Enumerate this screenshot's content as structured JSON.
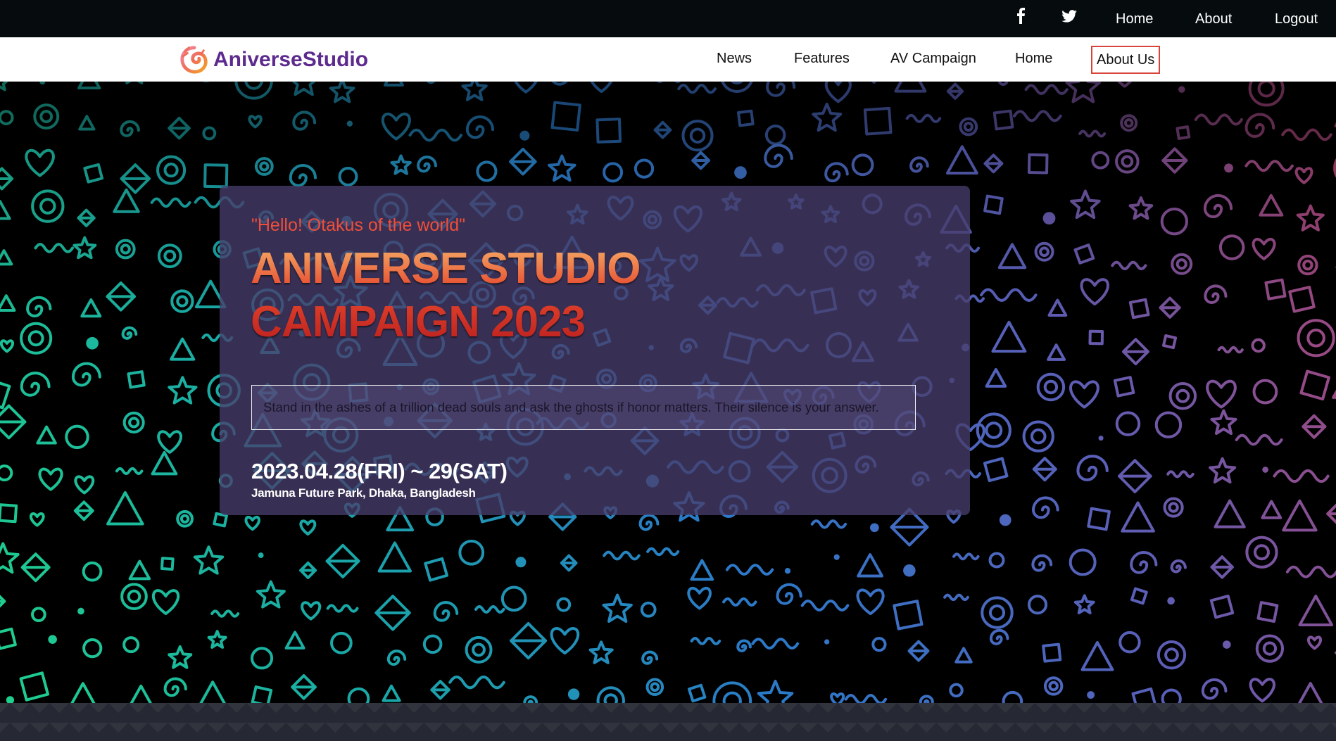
{
  "topbar": {
    "social": [
      {
        "name": "facebook-icon",
        "glyph": "f"
      },
      {
        "name": "twitter-icon",
        "glyph": "🐦"
      }
    ],
    "links": [
      "Home",
      "About",
      "Logout"
    ]
  },
  "navbar": {
    "brand": "AniverseStudio",
    "links": [
      "News",
      "Features",
      "AV Campaign",
      "Home",
      "About Us"
    ],
    "active_link_color": "#d9443a"
  },
  "hero": {
    "tagline": "\"Hello! Otakus of the world\"",
    "title_line1": "ANIVERSE STUDIO",
    "title_line2": "CAMPAIGN 2023",
    "quote": "Stand in the ashes of a trillion dead souls and ask the ghosts if honor matters. Their silence is your answer.",
    "date": "2023.04.28(FRI) ~ 29(SAT)",
    "venue": "Jamuna Future Park, Dhaka, Bangladesh"
  },
  "colors": {
    "topbar_bg": "#060c0e",
    "brand": "#5d2a8e",
    "tagline": "#f04e3a",
    "hero_gradient": [
      "#1fd08d",
      "#1aa6a8",
      "#2b79c9",
      "#5a5fb8",
      "#b2416e"
    ],
    "card_bg": "#483e6c"
  }
}
